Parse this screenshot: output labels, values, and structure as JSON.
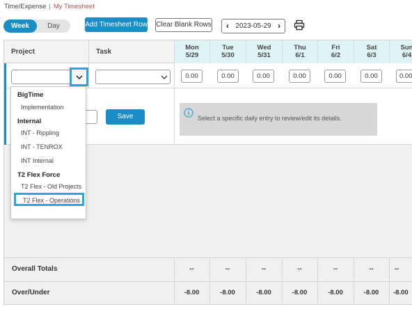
{
  "breadcrumb": {
    "parent": "Time/Expense",
    "separator": "|",
    "current": "My Timesheet"
  },
  "toolbar": {
    "view_toggle": {
      "week": "Week",
      "day": "Day",
      "selected": "Week"
    },
    "add_row_label": "Add Timesheet Row",
    "clear_rows_label": "Clear Blank Rows",
    "date": "2023-05-29",
    "prev_icon": "chevron-left-icon",
    "next_icon": "chevron-right-icon",
    "print_icon": "printer-icon"
  },
  "grid": {
    "columns": {
      "project": "Project",
      "task": "Task"
    },
    "days": [
      {
        "dow": "Mon",
        "date": "5/29",
        "hours": "0.00",
        "total": "--",
        "over_under": "-8.00"
      },
      {
        "dow": "Tue",
        "date": "5/30",
        "hours": "0.00",
        "total": "--",
        "over_under": "-8.00"
      },
      {
        "dow": "Wed",
        "date": "5/31",
        "hours": "0.00",
        "total": "--",
        "over_under": "-8.00"
      },
      {
        "dow": "Thu",
        "date": "6/1",
        "hours": "0.00",
        "total": "--",
        "over_under": "-8.00"
      },
      {
        "dow": "Fri",
        "date": "6/2",
        "hours": "0.00",
        "total": "--",
        "over_under": "-8.00"
      },
      {
        "dow": "Sat",
        "date": "6/3",
        "hours": "0.00",
        "total": "--",
        "over_under": "-8.00"
      },
      {
        "dow": "Sun",
        "date": "6/4",
        "hours": "0.00",
        "total": "--",
        "over_under": "-8.00"
      }
    ],
    "project_value": "",
    "task_value": "",
    "save_label": "Save",
    "info_message": "Select a specific daily entry to review/edit its details.",
    "info_icon": "info-circle-icon",
    "totals_label": "Overall Totals",
    "over_under_label": "Over/Under"
  },
  "project_dropdown": {
    "groups": [
      {
        "name": "BigTime",
        "items": [
          "Implementation"
        ]
      },
      {
        "name": "Internal",
        "items": [
          "INT - Rippling",
          "INT - TENROX",
          "INT Internal"
        ]
      },
      {
        "name": "T2 Flex Force",
        "items": [
          "T2 Flex - Old Projects",
          "T2 Flex - Operations"
        ]
      }
    ],
    "highlighted_item": "T2 Flex - Operations"
  },
  "colors": {
    "accent": "#1a8cc6",
    "highlight": "#2aa7d9",
    "breadcrumb_active": "#c0504d",
    "day_header_bg": "#e0f4f7"
  }
}
